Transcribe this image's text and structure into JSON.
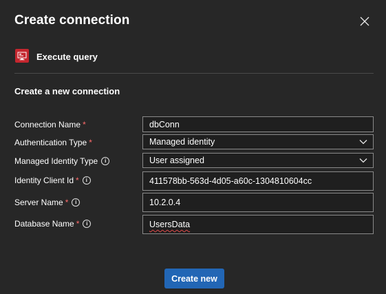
{
  "dialog": {
    "title": "Create connection",
    "action_name": "Execute query",
    "section_title": "Create a new connection"
  },
  "form": {
    "fields": [
      {
        "label": "Connection Name",
        "required": "*",
        "value": "dbConn",
        "type": "text"
      },
      {
        "label": "Authentication Type",
        "required": "*",
        "value": "Managed identity",
        "type": "select"
      },
      {
        "label": "Managed Identity Type",
        "required": "",
        "value": "User assigned",
        "type": "select",
        "info": "i"
      },
      {
        "label": "Identity Client Id",
        "required": "*",
        "value": "411578bb-563d-4d05-a60c-1304810604cc",
        "type": "text",
        "info": "i"
      },
      {
        "label": "Server Name",
        "required": "*",
        "value": "10.2.0.4",
        "type": "text",
        "info": "i"
      },
      {
        "label": "Database Name",
        "required": "*",
        "value": "UsersData",
        "type": "text",
        "info": "i"
      }
    ]
  },
  "buttons": {
    "create_label": "Create new"
  },
  "icons": {
    "close": "close-icon",
    "action": "sql-server-icon",
    "dropdown": "chevron-down-icon",
    "info": "info-icon"
  },
  "colors": {
    "background": "#272727",
    "primary_button": "#2266b5",
    "action_icon_bg": "#c4262e",
    "required_asterisk": "#ff6b6b"
  }
}
